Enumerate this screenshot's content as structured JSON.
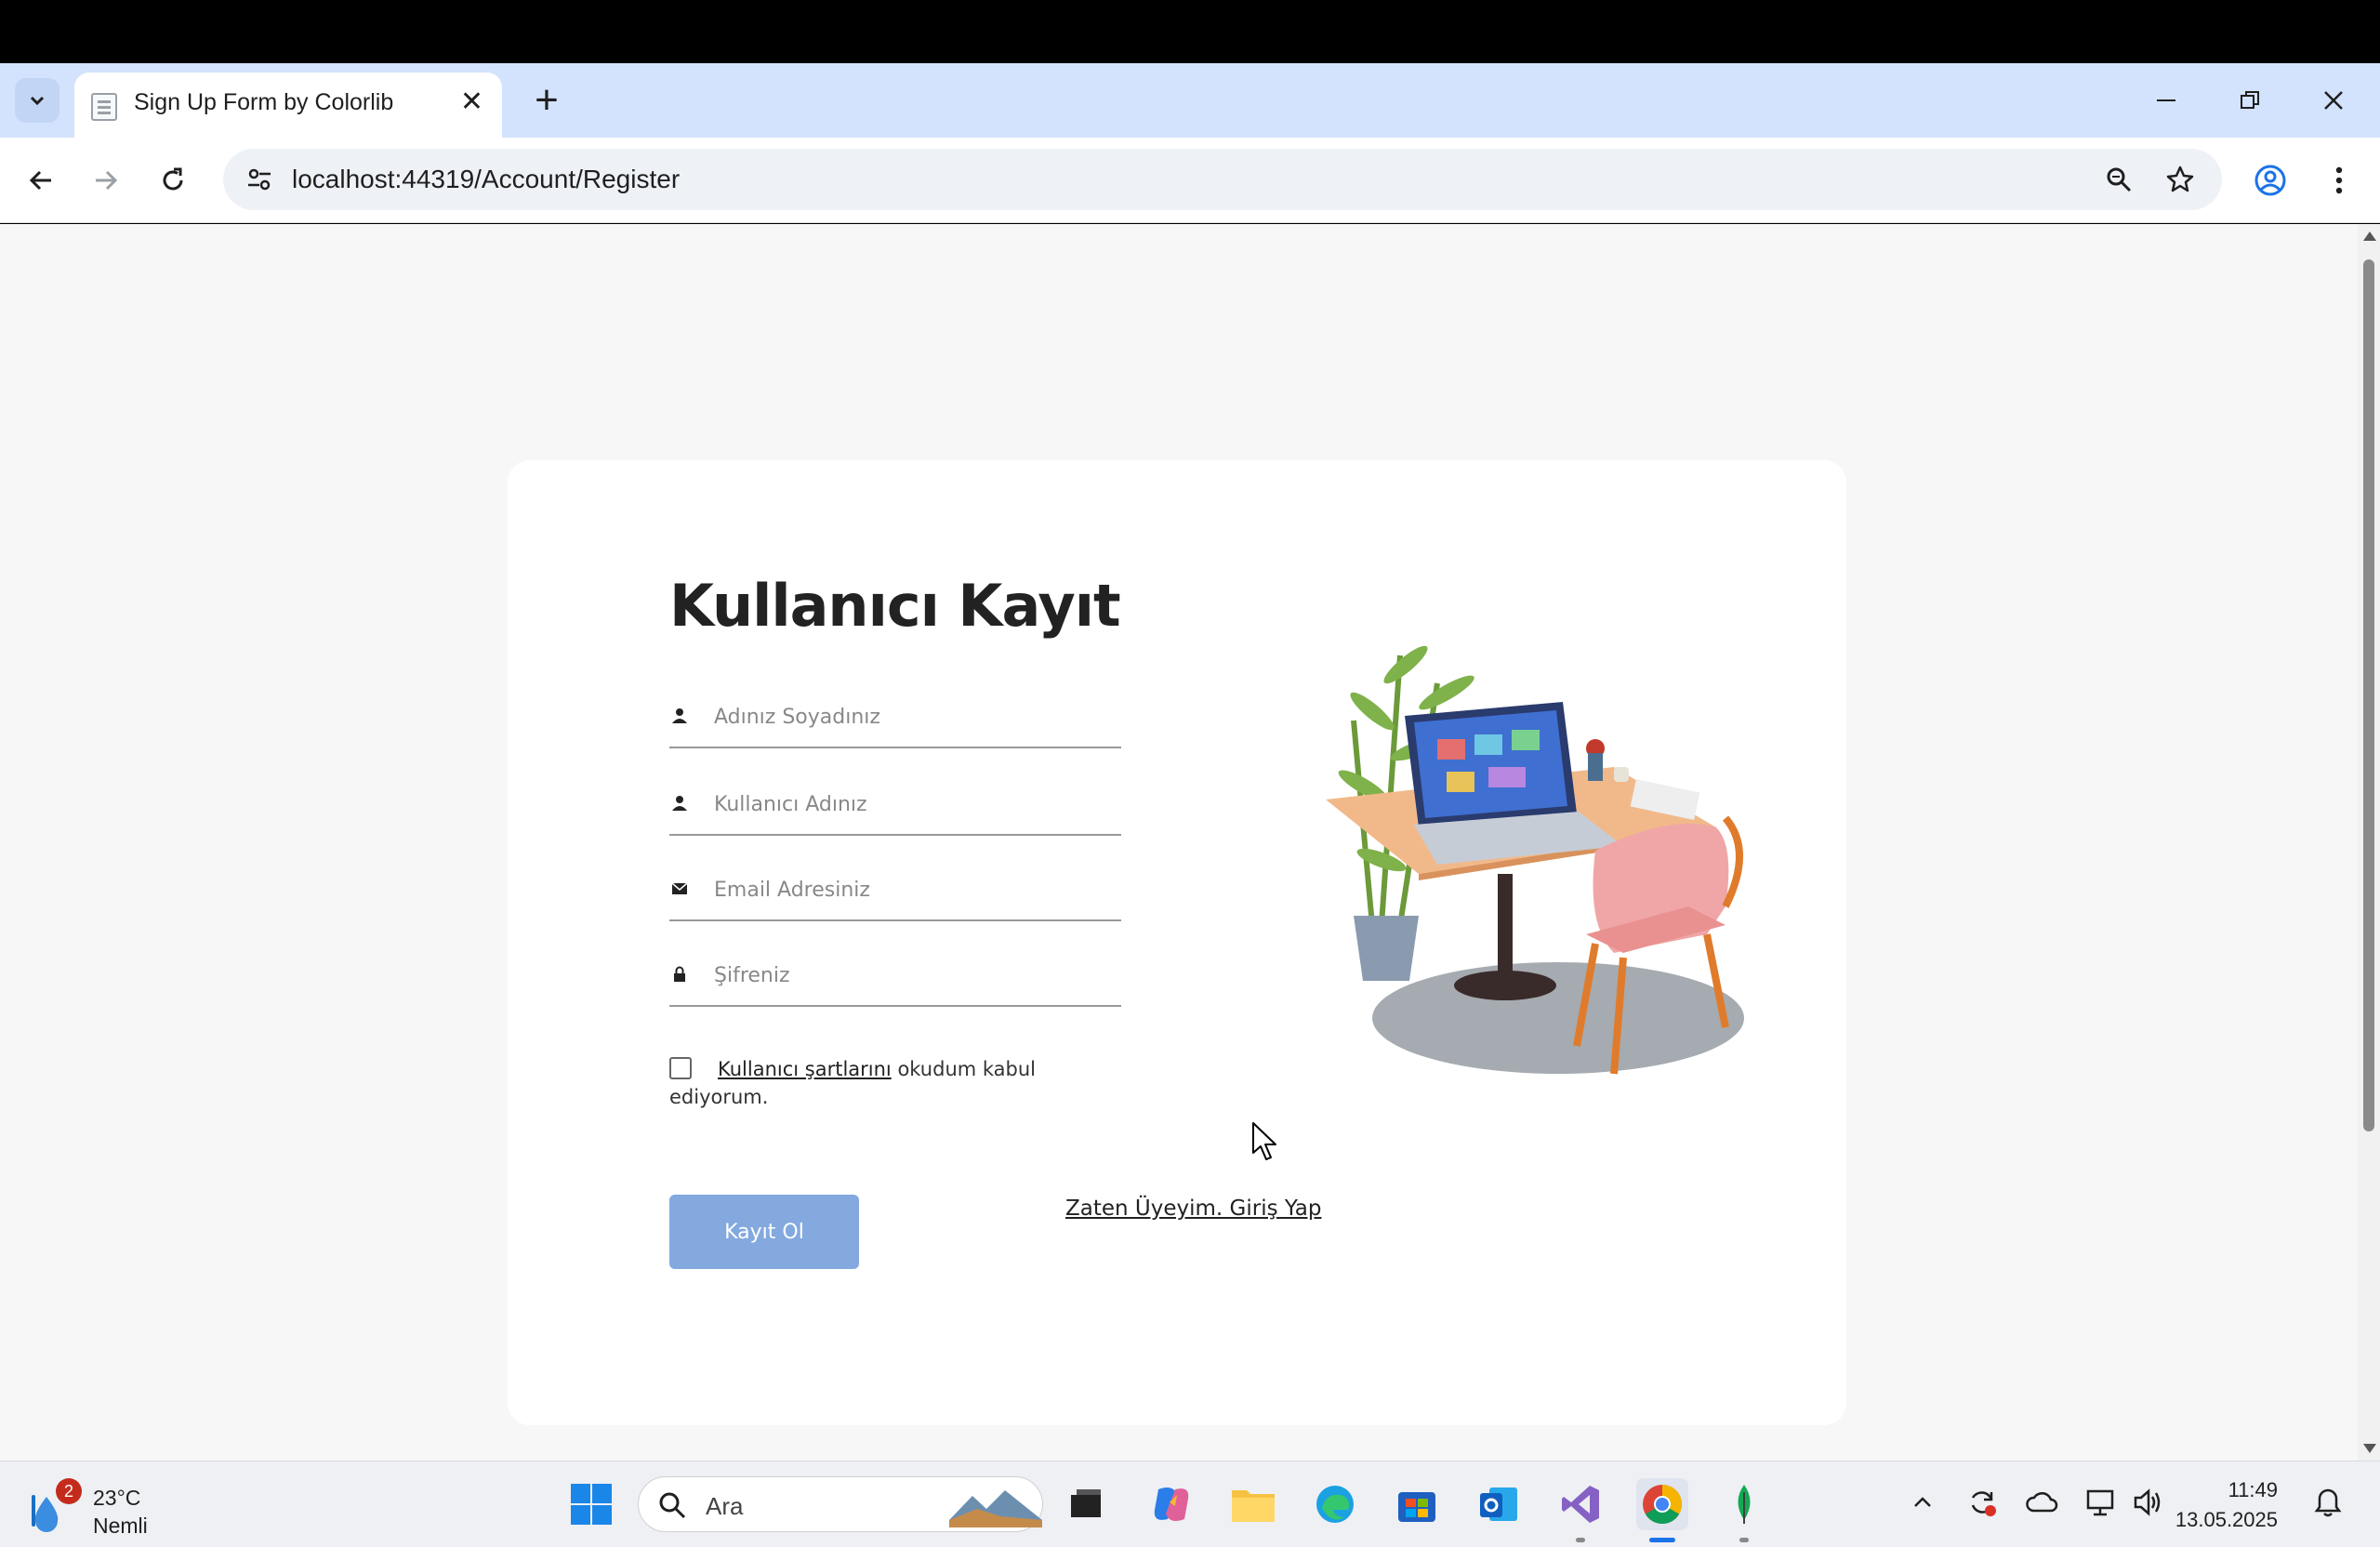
{
  "browser": {
    "tab_title": "Sign Up Form by Colorlib",
    "close_glyph": "✕",
    "new_tab_glyph": "+",
    "url": "localhost:44319/Account/Register"
  },
  "form": {
    "title": "Kullanıcı Kayıt",
    "fields": [
      {
        "placeholder": "Adınız Soyadınız",
        "icon": "user-icon"
      },
      {
        "placeholder": "Kullanıcı Adınız",
        "icon": "user-icon"
      },
      {
        "placeholder": "Email Adresiniz",
        "icon": "envelope-icon"
      },
      {
        "placeholder": "Şifreniz",
        "icon": "lock-icon"
      }
    ],
    "terms_link": "Kullanıcı şartlarını",
    "terms_text": " okudum kabul ediyorum.",
    "submit_label": "Kayıt Ol",
    "login_link": "Zaten Üyeyim. Giriş Yap"
  },
  "taskbar": {
    "weather_badge": "2",
    "weather_temp": "23°C",
    "weather_desc": "Nemli",
    "search_label": "Ara",
    "time": "11:49",
    "date": "13.05.2025"
  },
  "colors": {
    "submit": "#83a9df",
    "tabbar": "#d3e3fd"
  }
}
